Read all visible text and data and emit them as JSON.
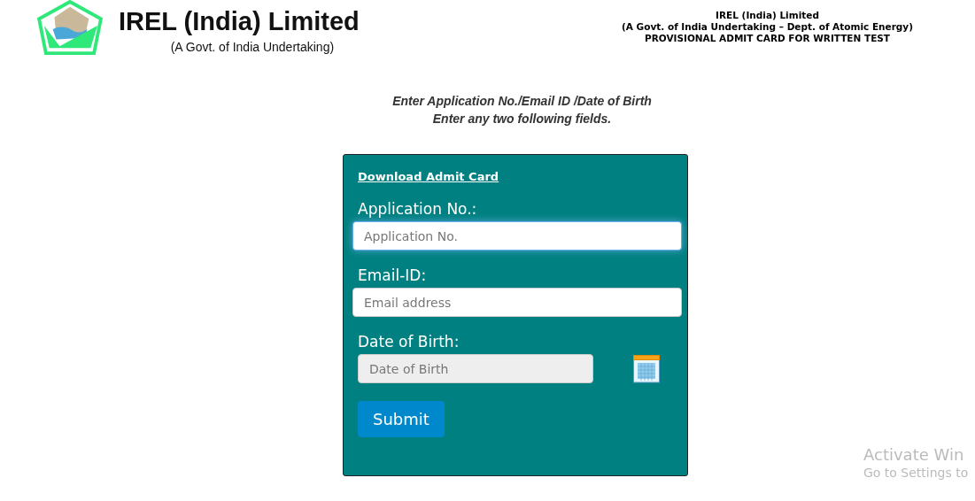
{
  "brand": {
    "name": "IREL (India) Limited",
    "tagline": "(A Govt. of India Undertaking)"
  },
  "header_info": [
    "IREL (India) Limited",
    "(A Govt. of India Undertaking – Dept. of Atomic Energy)",
    "PROVISIONAL ADMIT CARD FOR WRITTEN TEST"
  ],
  "instructions": [
    "Enter Application No./Email ID /Date of Birth",
    "Enter any two following fields."
  ],
  "form": {
    "link": "Download Admit Card",
    "fields": [
      {
        "kind": "text",
        "label": "Application No.:",
        "placeholder": "Application No.",
        "focused": true,
        "disabled": false
      },
      {
        "kind": "text",
        "label": "Email-ID:",
        "placeholder": "Email address",
        "focused": false,
        "disabled": false
      },
      {
        "kind": "date",
        "label": "Date of Birth:",
        "placeholder": "Date of Birth",
        "focused": false,
        "disabled": true
      }
    ],
    "submit": "Submit"
  },
  "activation_notice": {
    "title": "Activate Win",
    "subtitle": "Go to Settings to"
  }
}
